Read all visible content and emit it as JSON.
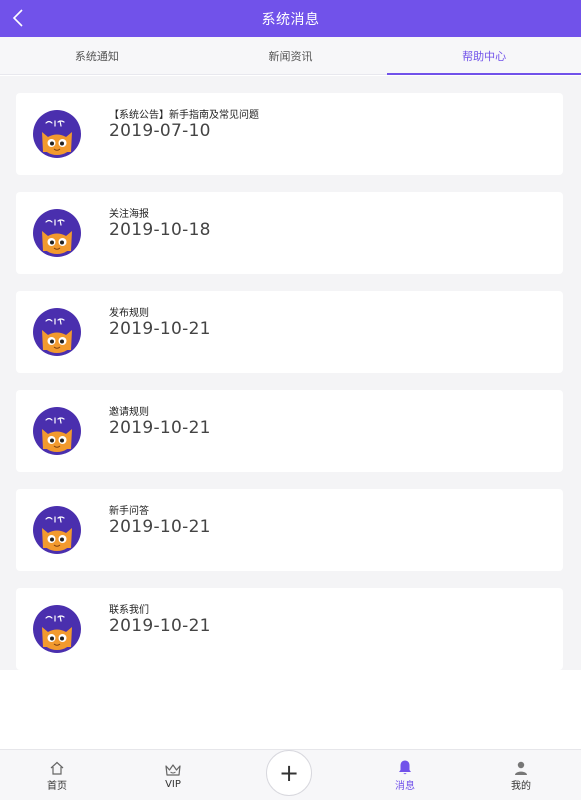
{
  "header": {
    "title": "系统消息",
    "back_icon": "chevron-left-icon",
    "bg_color": "#7152ea"
  },
  "tabs": [
    {
      "label": "系统通知",
      "active": false
    },
    {
      "label": "新闻资讯",
      "active": false
    },
    {
      "label": "帮助中心",
      "active": true
    }
  ],
  "messages": [
    {
      "title": "【系统公告】新手指南及常见问题",
      "date": "2019-07-10",
      "avatar": "cat-avatar-icon"
    },
    {
      "title": "关注海报",
      "date": "2019-10-18",
      "avatar": "cat-avatar-icon"
    },
    {
      "title": "发布规则",
      "date": "2019-10-21",
      "avatar": "cat-avatar-icon"
    },
    {
      "title": "邀请规则",
      "date": "2019-10-21",
      "avatar": "cat-avatar-icon"
    },
    {
      "title": "新手问答",
      "date": "2019-10-21",
      "avatar": "cat-avatar-icon"
    },
    {
      "title": "联系我们",
      "date": "2019-10-21",
      "avatar": "cat-avatar-icon"
    }
  ],
  "bottom_nav": {
    "items": [
      {
        "label": "首页",
        "icon": "home-icon",
        "active": false
      },
      {
        "label": "VIP",
        "icon": "crown-icon",
        "active": false
      },
      {
        "label": "消息",
        "icon": "bell-icon",
        "active": true
      },
      {
        "label": "我的",
        "icon": "user-icon",
        "active": false
      }
    ],
    "plus_label": "+"
  },
  "accent_color": "#7152ea"
}
